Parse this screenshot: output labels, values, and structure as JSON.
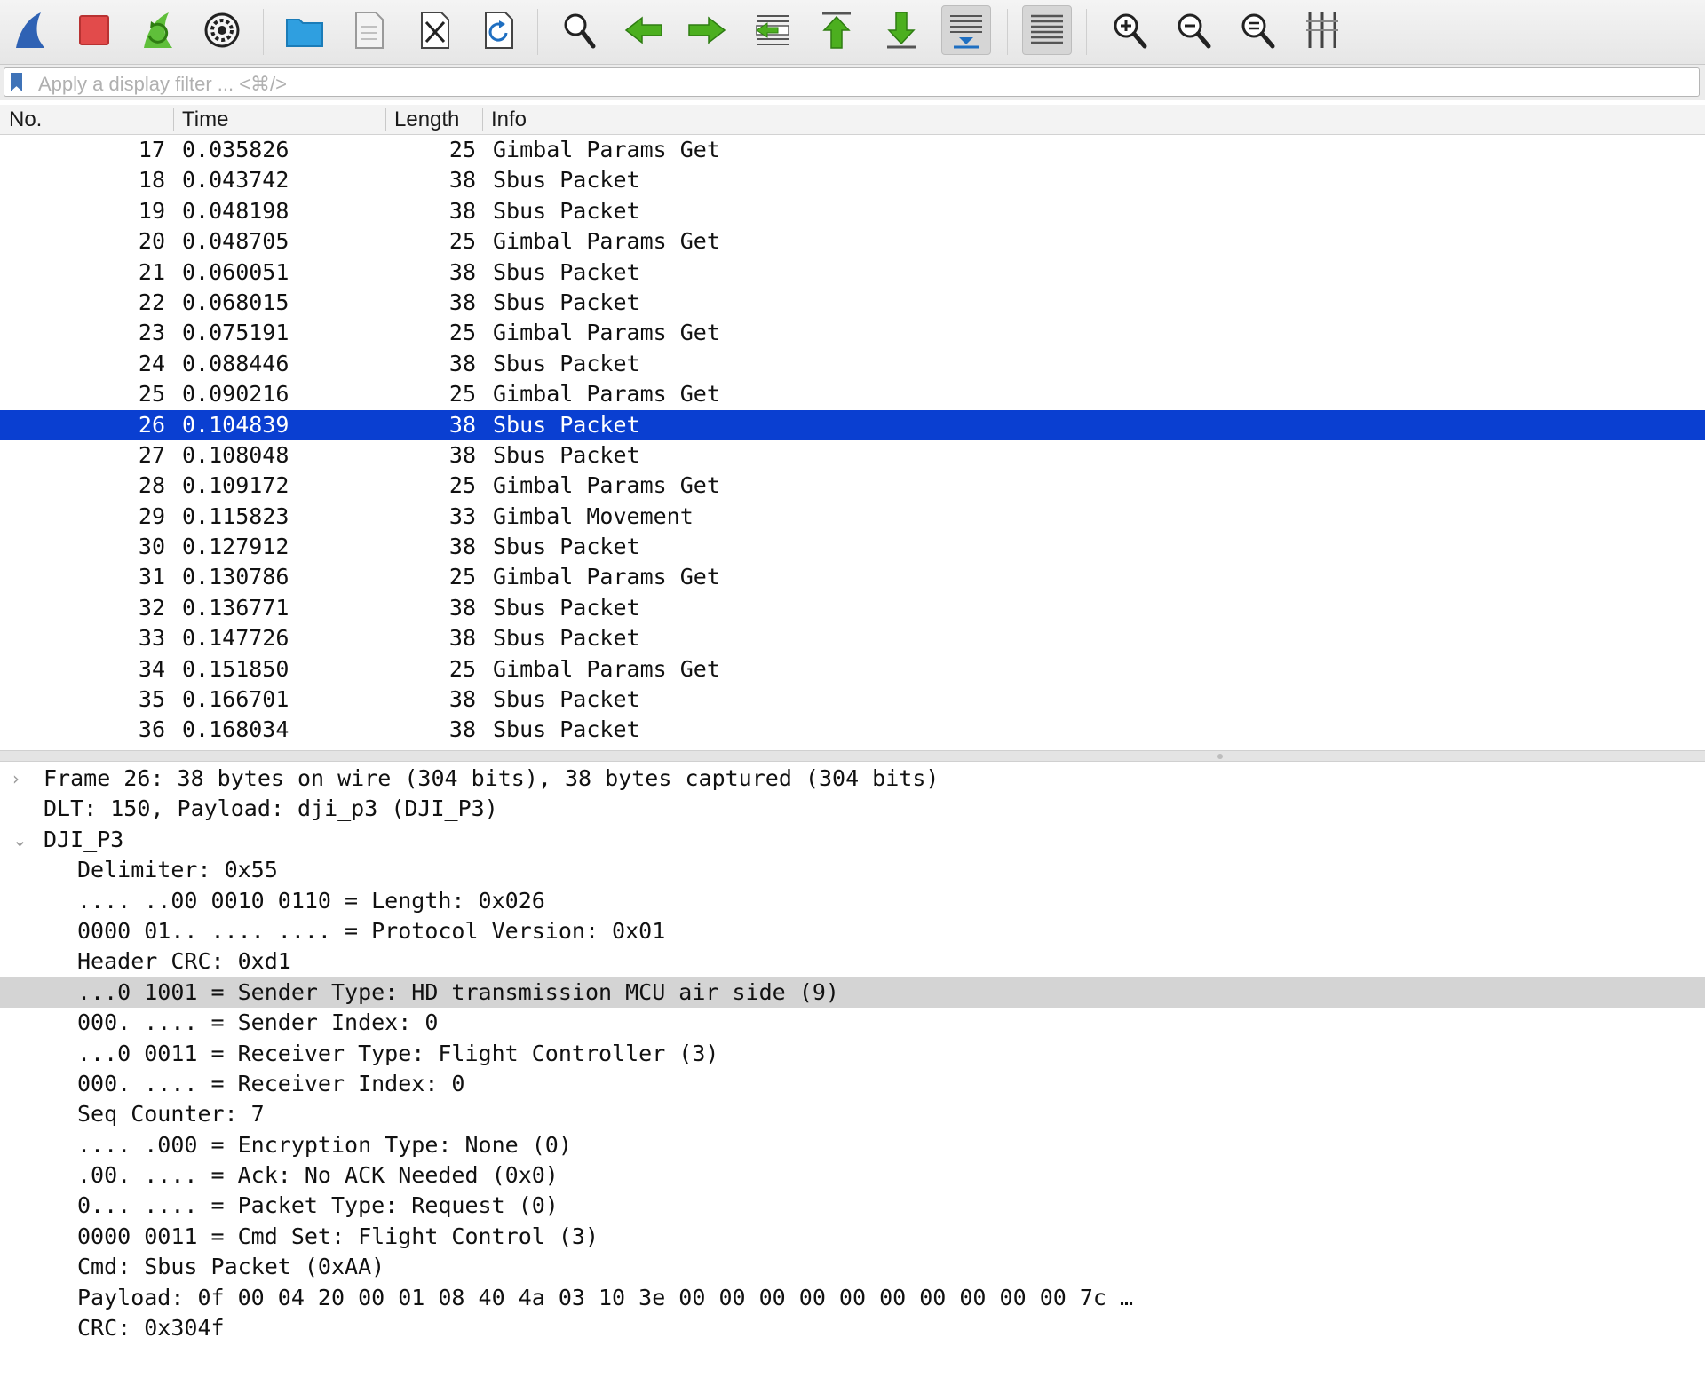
{
  "toolbar": {
    "buttons": [
      {
        "id": "start-capture",
        "icon": "shark-fin-icon"
      },
      {
        "id": "stop-capture",
        "icon": "stop-square-icon"
      },
      {
        "id": "restart-capture",
        "icon": "restart-fin-icon"
      },
      {
        "id": "capture-options",
        "icon": "gear-icon"
      },
      {
        "id": "open-file",
        "icon": "folder-icon"
      },
      {
        "id": "save-file",
        "icon": "document-icon"
      },
      {
        "id": "close-file",
        "icon": "close-file-icon"
      },
      {
        "id": "reload-file",
        "icon": "reload-icon"
      },
      {
        "id": "find-packet",
        "icon": "magnifier-icon"
      },
      {
        "id": "go-back",
        "icon": "arrow-left-icon"
      },
      {
        "id": "go-forward",
        "icon": "arrow-right-icon"
      },
      {
        "id": "go-to-packet",
        "icon": "go-to-packet-icon"
      },
      {
        "id": "go-first",
        "icon": "arrow-up-icon"
      },
      {
        "id": "go-last",
        "icon": "arrow-down-icon"
      },
      {
        "id": "autoscroll",
        "icon": "autoscroll-icon"
      },
      {
        "id": "colorize",
        "icon": "colorize-lines-icon"
      },
      {
        "id": "zoom-in",
        "icon": "zoom-in-icon"
      },
      {
        "id": "zoom-out",
        "icon": "zoom-out-icon"
      },
      {
        "id": "zoom-normal",
        "icon": "zoom-normal-icon"
      },
      {
        "id": "resize-columns",
        "icon": "resize-columns-icon"
      }
    ],
    "colors": {
      "blue": "#2f62b4",
      "red": "#e24b4b",
      "green": "#4caf1f",
      "folder": "#2f9fe0"
    }
  },
  "filter": {
    "placeholder": "Apply a display filter ... <⌘/>"
  },
  "columns": {
    "no": "No.",
    "time": "Time",
    "length": "Length",
    "info": "Info"
  },
  "packets": [
    {
      "no": "17",
      "time": "0.035826",
      "length": "25",
      "info": "Gimbal Params Get"
    },
    {
      "no": "18",
      "time": "0.043742",
      "length": "38",
      "info": "Sbus Packet"
    },
    {
      "no": "19",
      "time": "0.048198",
      "length": "38",
      "info": "Sbus Packet"
    },
    {
      "no": "20",
      "time": "0.048705",
      "length": "25",
      "info": "Gimbal Params Get"
    },
    {
      "no": "21",
      "time": "0.060051",
      "length": "38",
      "info": "Sbus Packet"
    },
    {
      "no": "22",
      "time": "0.068015",
      "length": "38",
      "info": "Sbus Packet"
    },
    {
      "no": "23",
      "time": "0.075191",
      "length": "25",
      "info": "Gimbal Params Get"
    },
    {
      "no": "24",
      "time": "0.088446",
      "length": "38",
      "info": "Sbus Packet"
    },
    {
      "no": "25",
      "time": "0.090216",
      "length": "25",
      "info": "Gimbal Params Get"
    },
    {
      "no": "26",
      "time": "0.104839",
      "length": "38",
      "info": "Sbus Packet"
    },
    {
      "no": "27",
      "time": "0.108048",
      "length": "38",
      "info": "Sbus Packet"
    },
    {
      "no": "28",
      "time": "0.109172",
      "length": "25",
      "info": "Gimbal Params Get"
    },
    {
      "no": "29",
      "time": "0.115823",
      "length": "33",
      "info": "Gimbal Movement"
    },
    {
      "no": "30",
      "time": "0.127912",
      "length": "38",
      "info": "Sbus Packet"
    },
    {
      "no": "31",
      "time": "0.130786",
      "length": "25",
      "info": "Gimbal Params Get"
    },
    {
      "no": "32",
      "time": "0.136771",
      "length": "38",
      "info": "Sbus Packet"
    },
    {
      "no": "33",
      "time": "0.147726",
      "length": "38",
      "info": "Sbus Packet"
    },
    {
      "no": "34",
      "time": "0.151850",
      "length": "25",
      "info": "Gimbal Params Get"
    },
    {
      "no": "35",
      "time": "0.166701",
      "length": "38",
      "info": "Sbus Packet"
    },
    {
      "no": "36",
      "time": "0.168034",
      "length": "38",
      "info": "Sbus Packet"
    }
  ],
  "selected_packet": "26",
  "selection_color": "#0a3fd1",
  "details": [
    {
      "text": "Frame 26: 38 bytes on wire (304 bits), 38 bytes captured (304 bits)",
      "level": 0,
      "toggle": "collapsed"
    },
    {
      "text": "DLT: 150, Payload: dji_p3 (DJI_P3)",
      "level": 0,
      "toggle": "none"
    },
    {
      "text": "DJI_P3",
      "level": 0,
      "toggle": "expanded"
    },
    {
      "text": "Delimiter: 0x55",
      "level": 1,
      "toggle": "none"
    },
    {
      "text": ".... ..00 0010 0110 = Length: 0x026",
      "level": 1,
      "toggle": "none"
    },
    {
      "text": "0000 01.. .... .... = Protocol Version: 0x01",
      "level": 1,
      "toggle": "none"
    },
    {
      "text": "Header CRC: 0xd1",
      "level": 1,
      "toggle": "none"
    },
    {
      "text": "...0 1001 = Sender Type: HD transmission MCU air side (9)",
      "level": 1,
      "toggle": "none",
      "highlighted": true
    },
    {
      "text": "000. .... = Sender Index: 0",
      "level": 1,
      "toggle": "none"
    },
    {
      "text": "...0 0011 = Receiver Type: Flight Controller (3)",
      "level": 1,
      "toggle": "none"
    },
    {
      "text": "000. .... = Receiver Index: 0",
      "level": 1,
      "toggle": "none"
    },
    {
      "text": "Seq Counter: 7",
      "level": 1,
      "toggle": "none"
    },
    {
      "text": ".... .000 = Encryption Type: None (0)",
      "level": 1,
      "toggle": "none"
    },
    {
      "text": ".00. .... = Ack: No ACK Needed (0x0)",
      "level": 1,
      "toggle": "none"
    },
    {
      "text": "0... .... = Packet Type: Request (0)",
      "level": 1,
      "toggle": "none"
    },
    {
      "text": "0000 0011 = Cmd Set: Flight Control (3)",
      "level": 1,
      "toggle": "none"
    },
    {
      "text": "Cmd: Sbus Packet (0xAA)",
      "level": 1,
      "toggle": "none"
    },
    {
      "text": "Payload: 0f 00 04 20 00 01 08 40 4a 03 10 3e 00 00 00 00 00 00 00 00 00 00 7c …",
      "level": 1,
      "toggle": "none"
    },
    {
      "text": "CRC: 0x304f",
      "level": 1,
      "toggle": "none"
    }
  ]
}
